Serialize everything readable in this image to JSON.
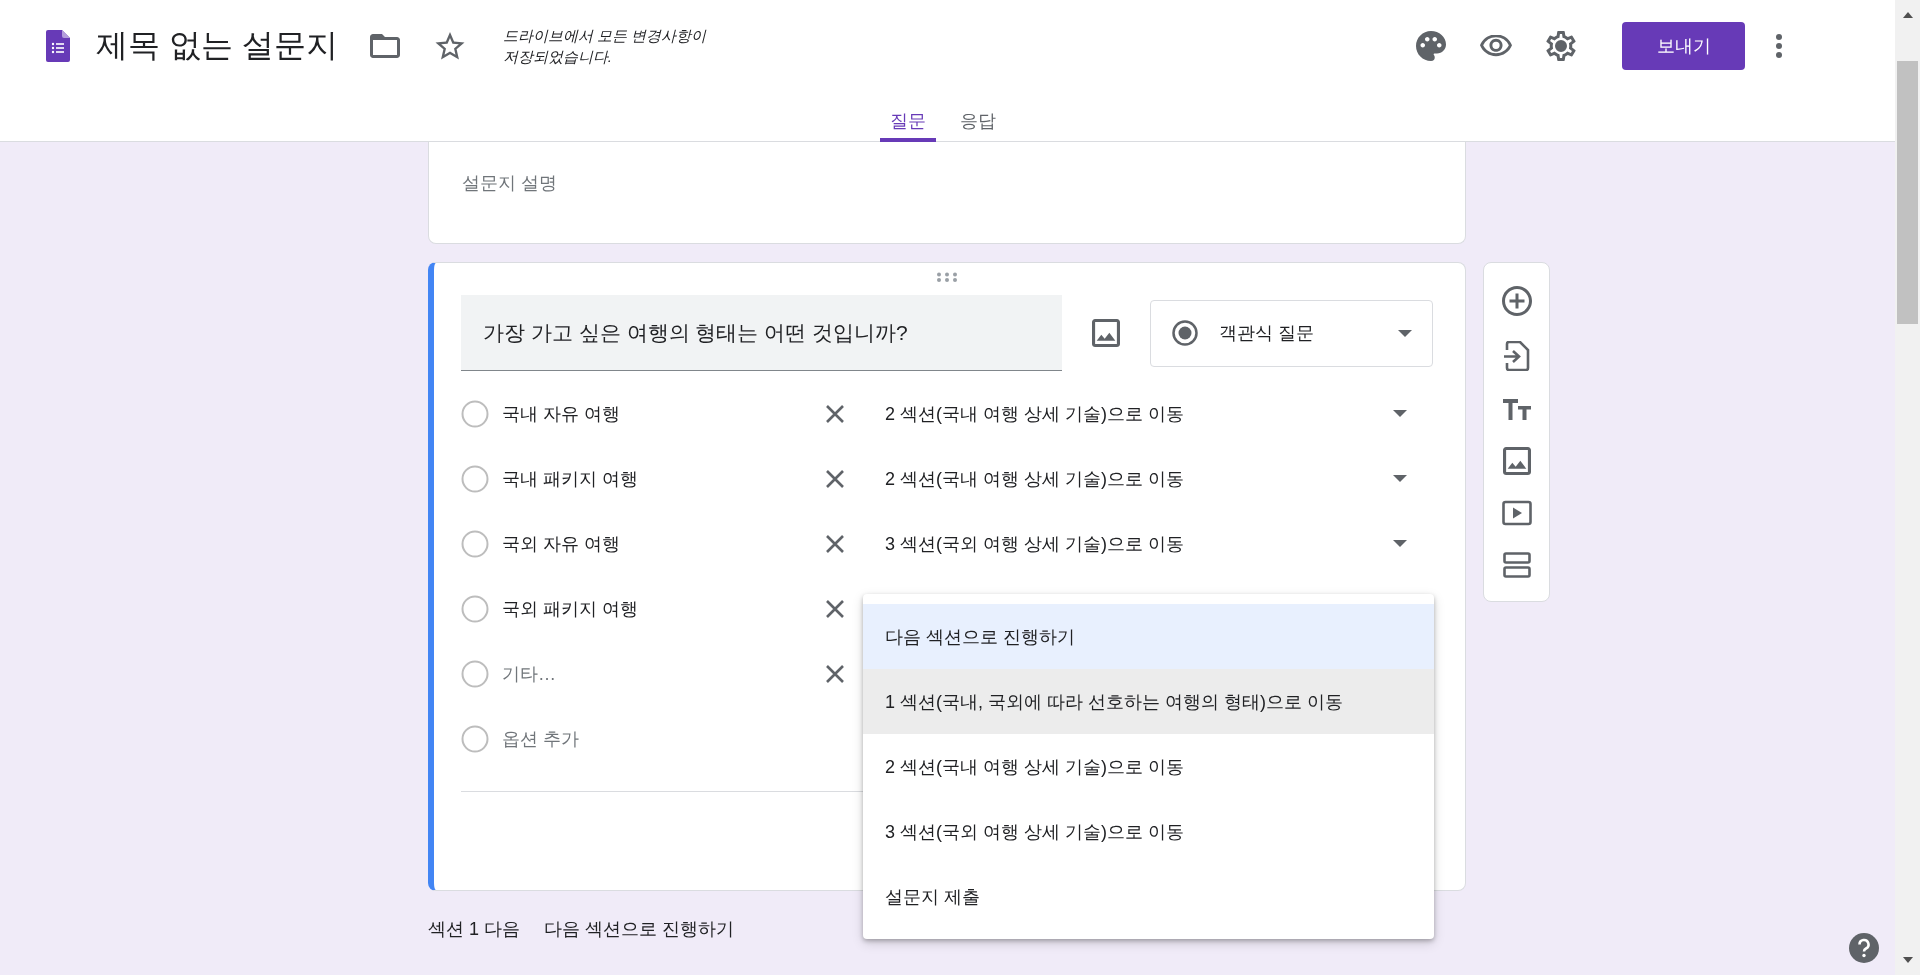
{
  "header": {
    "title": "제목 없는 설문지",
    "save_status": "드라이브에서 모든 변경사항이 저장되었습니다.",
    "send_button": "보내기"
  },
  "tabs": [
    {
      "label": "질문",
      "selected": true
    },
    {
      "label": "응답",
      "selected": false
    }
  ],
  "description_card": {
    "placeholder": "설문지 설명"
  },
  "question": {
    "title": "가장 가고 싶은 여행의 형태는 어떤 것입니까?",
    "type": "객관식 질문",
    "options": [
      {
        "kind": "option",
        "label": "국내 자유 여행",
        "go_to": "2 섹션(국내 여행 상세 기술)으로 이동"
      },
      {
        "kind": "option",
        "label": "국내 패키지 여행",
        "go_to": "2 섹션(국내 여행 상세 기술)으로 이동"
      },
      {
        "kind": "option",
        "label": "국외 자유 여행",
        "go_to": "3 섹션(국외 여행 상세 기술)으로 이동"
      },
      {
        "kind": "option",
        "label": "국외 패키지 여행"
      },
      {
        "kind": "other",
        "label": "기타…"
      },
      {
        "kind": "add",
        "label": "옵션 추가"
      }
    ]
  },
  "go_to_menu": {
    "items": [
      {
        "label": "다음 섹션으로 진행하기",
        "selected": true,
        "hovered": false
      },
      {
        "label": "1 섹션(국내, 국외에 따라 선호하는 여행의 형태)으로 이동",
        "selected": false,
        "hovered": true
      },
      {
        "label": "2 섹션(국내 여행 상세 기술)으로 이동",
        "selected": false,
        "hovered": false
      },
      {
        "label": "3 섹션(국외 여행 상세 기술)으로 이동",
        "selected": false,
        "hovered": false
      },
      {
        "label": "설문지 제출",
        "selected": false,
        "hovered": false
      }
    ]
  },
  "section_footer": {
    "label": "섹션 1 다음",
    "value": "다음 섹션으로 진행하기"
  }
}
